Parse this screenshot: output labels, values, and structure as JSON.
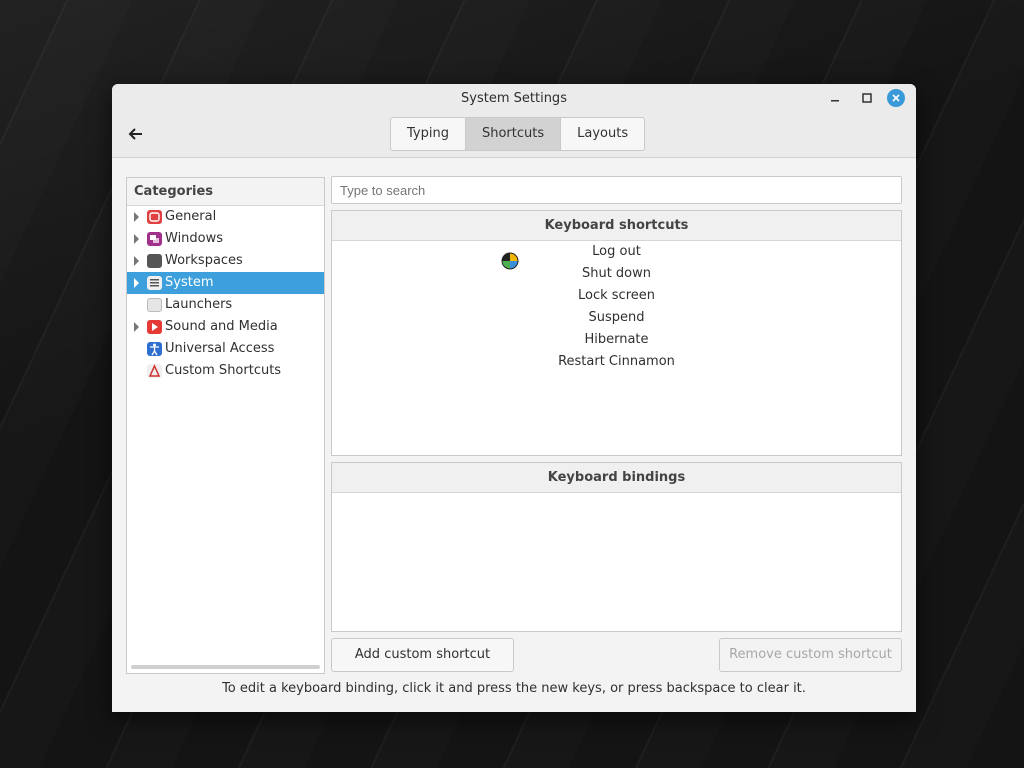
{
  "window": {
    "title": "System Settings",
    "accent": "#3da0dc",
    "close_color": "#3a9ad9"
  },
  "tabs": [
    {
      "label": "Typing",
      "active": false
    },
    {
      "label": "Shortcuts",
      "active": true
    },
    {
      "label": "Layouts",
      "active": false
    }
  ],
  "sidebar": {
    "header": "Categories",
    "items": [
      {
        "label": "General",
        "icon": "general-icon",
        "color": "#e04040",
        "expandable": true,
        "selected": false
      },
      {
        "label": "Windows",
        "icon": "windows-icon",
        "color": "#a0308a",
        "expandable": true,
        "selected": false
      },
      {
        "label": "Workspaces",
        "icon": "workspaces-icon",
        "color": "#555555",
        "expandable": true,
        "selected": false
      },
      {
        "label": "System",
        "icon": "system-icon",
        "color": "#6a6a6a",
        "expandable": true,
        "selected": true
      },
      {
        "label": "Launchers",
        "icon": "launchers-icon",
        "color": "#bdbdbd",
        "expandable": false,
        "selected": false
      },
      {
        "label": "Sound and Media",
        "icon": "sound-media-icon",
        "color": "#e53935",
        "expandable": true,
        "selected": false
      },
      {
        "label": "Universal Access",
        "icon": "universal-access-icon",
        "color": "#2f6fd0",
        "expandable": false,
        "selected": false
      },
      {
        "label": "Custom Shortcuts",
        "icon": "custom-shortcuts-icon",
        "color": "#d03030",
        "expandable": false,
        "selected": false
      }
    ]
  },
  "search": {
    "placeholder": "Type to search"
  },
  "shortcuts_panel": {
    "header": "Keyboard shortcuts",
    "items": [
      "Log out",
      "Shut down",
      "Lock screen",
      "Suspend",
      "Hibernate",
      "Restart Cinnamon"
    ]
  },
  "bindings_panel": {
    "header": "Keyboard bindings"
  },
  "buttons": {
    "add": "Add custom shortcut",
    "remove": "Remove custom shortcut"
  },
  "hint": "To edit a keyboard binding, click it and press the new keys, or press backspace to clear it."
}
